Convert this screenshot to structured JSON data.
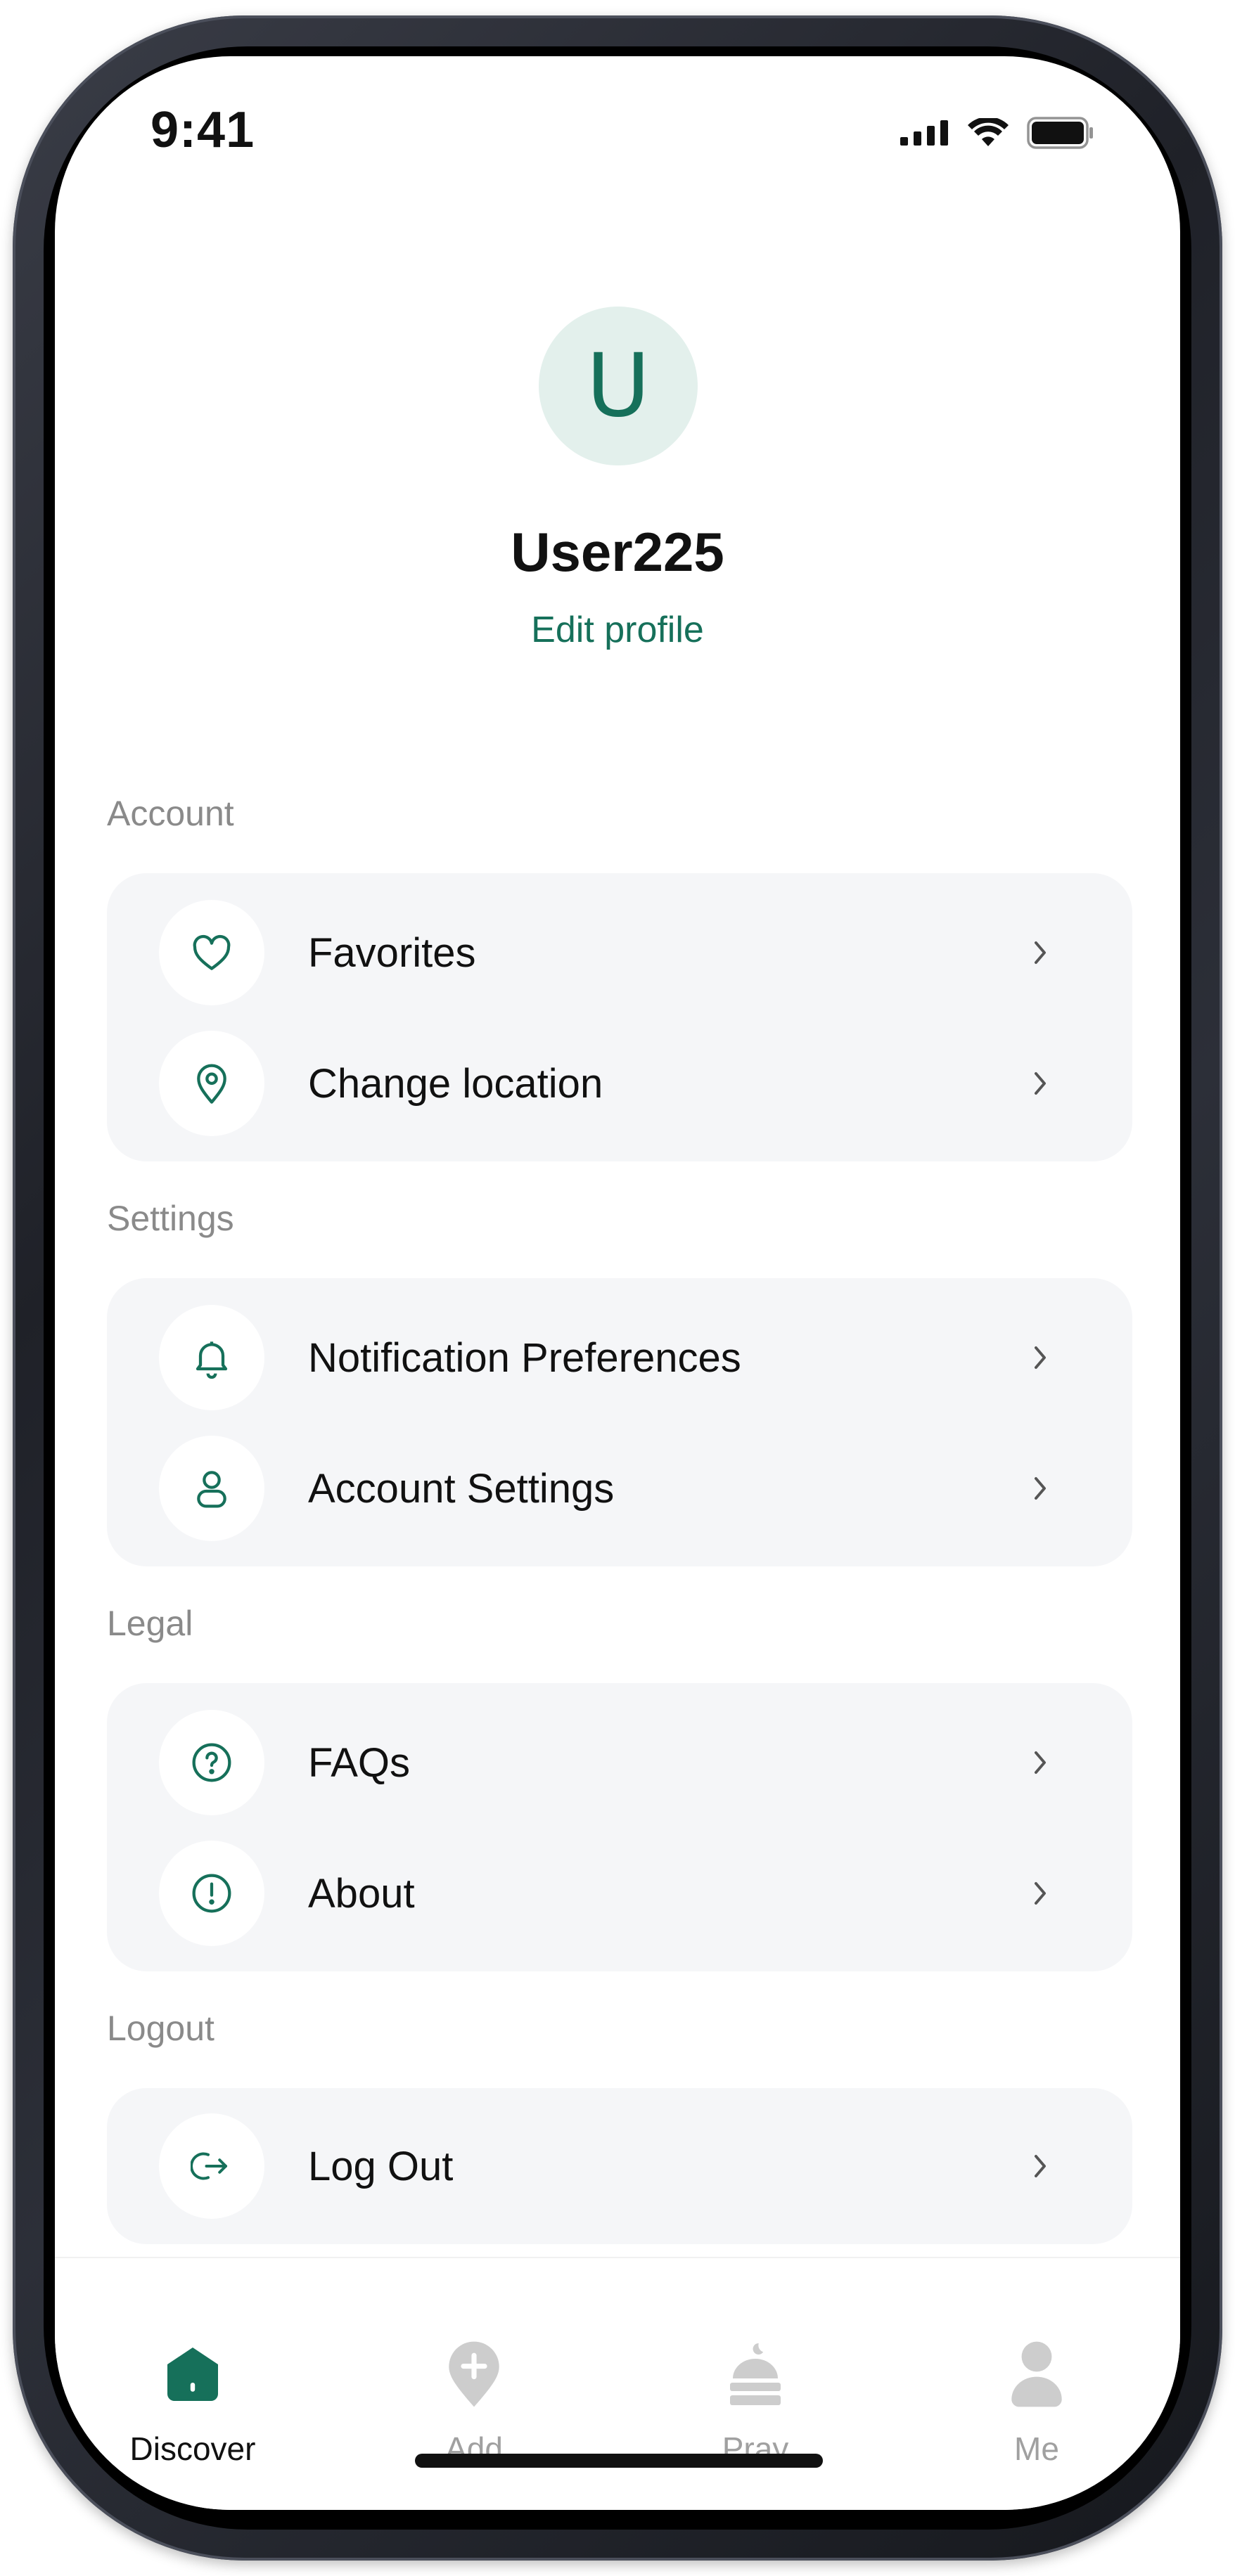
{
  "status_bar": {
    "time": "9:41"
  },
  "profile": {
    "avatar_letter": "U",
    "username": "User225",
    "edit_label": "Edit profile"
  },
  "sections": {
    "account": {
      "title": "Account",
      "items": [
        {
          "label": "Favorites",
          "icon": "heart-icon"
        },
        {
          "label": "Change location",
          "icon": "location-pin-icon"
        }
      ]
    },
    "settings": {
      "title": "Settings",
      "items": [
        {
          "label": "Notification Preferences",
          "icon": "bell-icon"
        },
        {
          "label": "Account Settings",
          "icon": "person-icon"
        }
      ]
    },
    "legal": {
      "title": "Legal",
      "items": [
        {
          "label": "FAQs",
          "icon": "question-circle-icon"
        },
        {
          "label": "About",
          "icon": "info-circle-icon"
        }
      ]
    },
    "logout": {
      "title": "Logout",
      "items": [
        {
          "label": "Log Out",
          "icon": "logout-icon"
        }
      ]
    }
  },
  "tabbar": {
    "tabs": [
      {
        "label": "Discover",
        "icon": "home-icon",
        "active": true
      },
      {
        "label": "Add",
        "icon": "add-pin-icon",
        "active": false
      },
      {
        "label": "Pray",
        "icon": "mosque-icon",
        "active": false
      },
      {
        "label": "Me",
        "icon": "user-icon",
        "active": false
      }
    ]
  },
  "colors": {
    "accent": "#16705a",
    "avatar_bg": "#e3f0ec",
    "card_bg": "#f5f6f8",
    "section_title": "#8a8a8a",
    "inactive_tab": "#c8c8c8"
  }
}
